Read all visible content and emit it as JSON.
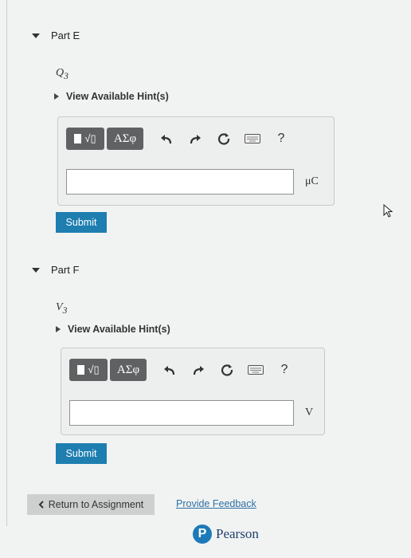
{
  "parts": [
    {
      "title": "Part E",
      "variable": "Q",
      "variable_sub": "3",
      "hint_label": "View Available Hint(s)",
      "toolbar": {
        "templates_glyph": "√▯",
        "greek_label": "ΑΣφ",
        "help_label": "?"
      },
      "input_value": "",
      "unit": "μC",
      "submit_label": "Submit"
    },
    {
      "title": "Part F",
      "variable": "V",
      "variable_sub": "3",
      "hint_label": "View Available Hint(s)",
      "toolbar": {
        "templates_glyph": "√▯",
        "greek_label": "ΑΣφ",
        "help_label": "?"
      },
      "input_value": "",
      "unit": "V",
      "submit_label": "Submit"
    }
  ],
  "footer": {
    "return_label": "Return to Assignment",
    "feedback_label": "Provide Feedback",
    "brand_letter": "P",
    "brand_name": "Pearson"
  },
  "colors": {
    "submit": "#1e7eb0",
    "toolbar_button": "#5f6163",
    "link": "#2f6fa7",
    "brand": "#1c7ab8"
  }
}
